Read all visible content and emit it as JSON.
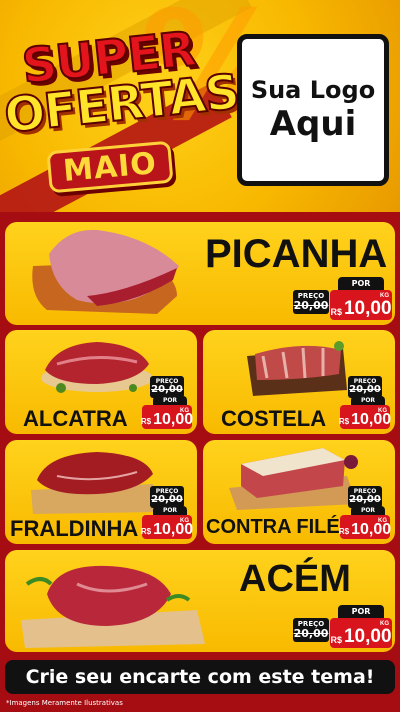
{
  "header": {
    "title_line1": "SUPER",
    "title_line2": "OFERTAS",
    "month": "MAIO",
    "percent_symbol": "%",
    "logo_line1": "Sua Logo",
    "logo_line2": "Aqui"
  },
  "price_labels": {
    "preco": "PREÇO",
    "por": "POR",
    "currency": "R$",
    "unit": "KG"
  },
  "products": [
    {
      "name": "PICANHA",
      "old_price": "20,00",
      "new_price": "10,00"
    },
    {
      "name": "ALCATRA",
      "old_price": "20,00",
      "new_price": "10,00"
    },
    {
      "name": "COSTELA",
      "old_price": "20,00",
      "new_price": "10,00"
    },
    {
      "name": "FRALDINHA",
      "old_price": "20,00",
      "new_price": "10,00"
    },
    {
      "name": "CONTRA FILÉ",
      "old_price": "20,00",
      "new_price": "10,00"
    },
    {
      "name": "ACÉM",
      "old_price": "20,00",
      "new_price": "10,00"
    }
  ],
  "footer": {
    "cta": "Crie seu encarte com este tema!",
    "disclaimer": "*Imagens Meramente Ilustrativas"
  },
  "colors": {
    "background_red": "#a50d12",
    "card_yellow": "#ffd21c",
    "price_red": "#d8141c",
    "text_black": "#111111"
  }
}
